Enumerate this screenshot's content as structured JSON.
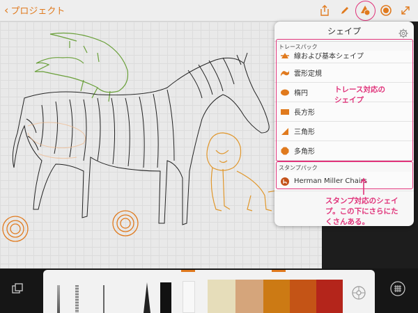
{
  "topbar": {
    "back_label": "プロジェクト",
    "icons": [
      "share-icon",
      "pen-icon",
      "shapes-icon",
      "stamp-icon",
      "expand-icon"
    ]
  },
  "popover": {
    "title": "シェイプ",
    "trace_section": "トレースパック",
    "trace_items": [
      {
        "label": "線および基本シェイプ",
        "icon": "line-shape-icon"
      },
      {
        "label": "雲形定規",
        "icon": "french-curve-icon"
      },
      {
        "label": "楕円",
        "icon": "ellipse-icon"
      },
      {
        "label": "長方形",
        "icon": "rectangle-icon"
      },
      {
        "label": "三角形",
        "icon": "triangle-icon"
      },
      {
        "label": "多角形",
        "icon": "polygon-icon"
      }
    ],
    "stamp_section": "スタンプパック",
    "stamp_items": [
      {
        "label": "Herman Miller Chairs",
        "icon": "chair-icon"
      }
    ]
  },
  "annotations": {
    "trace_note": [
      "トレース対応の",
      "シェイプ"
    ],
    "stamp_note": [
      "スタンプ対応のシェイ",
      "プ。この下にさらにた",
      "くさんある。"
    ]
  },
  "colors": {
    "accent": "#e07a1e",
    "highlight": "#e0337a",
    "swatches": [
      "#e6ddba",
      "#d5a57b",
      "#cc7a14",
      "#c45416",
      "#b4251b"
    ]
  }
}
